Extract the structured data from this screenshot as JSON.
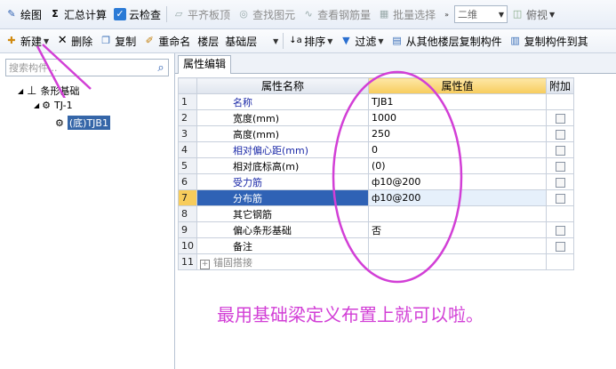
{
  "toolbar1": {
    "draw": "绘图",
    "sum": "汇总计算",
    "cloud_check": "云检查",
    "align_slab": "平齐板顶",
    "find_element": "查找图元",
    "view_rebar": "查看钢筋量",
    "batch_select": "批量选择",
    "view_mode": "二维",
    "view_dir": "俯视"
  },
  "toolbar2": {
    "new": "新建",
    "delete": "删除",
    "copy": "复制",
    "rename": "重命名",
    "floor_label": "楼层",
    "floor_value": "基础层",
    "sort": "排序",
    "filter": "过滤",
    "copy_from_floor": "从其他楼层复制构件",
    "copy_to": "复制构件到其"
  },
  "left": {
    "search_placeholder": "搜索构件...",
    "tree": {
      "root": "条形基础",
      "child": "TJ-1",
      "leaf": "(底)TJB1"
    }
  },
  "tab_label": "属性编辑",
  "table": {
    "headers": [
      "属性名称",
      "属性值",
      "附加"
    ],
    "rows": [
      {
        "n": "1",
        "name": "名称",
        "value": "TJB1",
        "blue": true,
        "checkbox": false
      },
      {
        "n": "2",
        "name": "宽度(mm)",
        "value": "1000",
        "blue": false,
        "checkbox": true
      },
      {
        "n": "3",
        "name": "高度(mm)",
        "value": "250",
        "blue": false,
        "checkbox": true
      },
      {
        "n": "4",
        "name": "相对偏心距(mm)",
        "value": "0",
        "blue": true,
        "checkbox": true
      },
      {
        "n": "5",
        "name": "相对底标高(m)",
        "value": "(0)",
        "blue": false,
        "checkbox": true
      },
      {
        "n": "6",
        "name": "受力筋",
        "value": "ф10@200",
        "blue": true,
        "checkbox": true
      },
      {
        "n": "7",
        "name": "分布筋",
        "value": "ф10@200",
        "blue": true,
        "checkbox": true
      },
      {
        "n": "8",
        "name": "其它钢筋",
        "value": "",
        "blue": false,
        "checkbox": false
      },
      {
        "n": "9",
        "name": "偏心条形基础",
        "value": "否",
        "blue": false,
        "checkbox": true
      },
      {
        "n": "10",
        "name": "备注",
        "value": "",
        "blue": false,
        "checkbox": true
      },
      {
        "n": "11",
        "name": "锚固搭接",
        "value": "",
        "blue": false,
        "checkbox": false
      }
    ]
  },
  "caption": "最用基础梁定义布置上就可以啦。",
  "colors": {
    "annotation": "#d23fd6",
    "selection": "#2f62b5",
    "header_highlight": "#f7cc5c"
  }
}
